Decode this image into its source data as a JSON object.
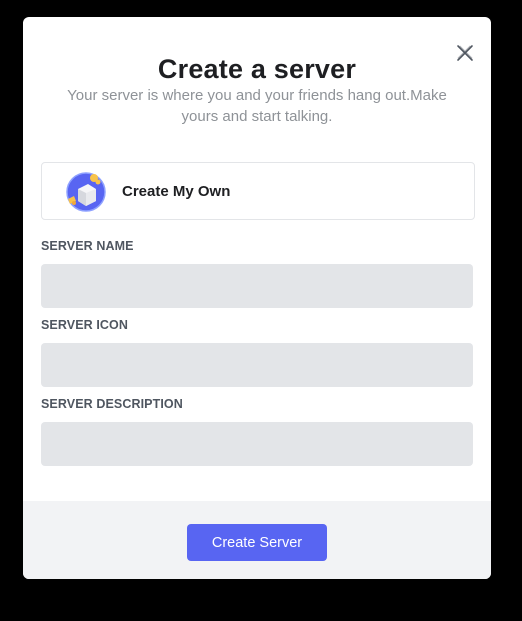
{
  "modal": {
    "title": "Create a server",
    "subtitle": "Your server is where you and your friends hang out.Make yours and start talking.",
    "close_icon": "close-icon"
  },
  "option": {
    "label": "Create My Own",
    "icon": "create-server-icon"
  },
  "fields": [
    {
      "label": "SERVER NAME",
      "value": "",
      "placeholder": ""
    },
    {
      "label": "SERVER ICON",
      "value": "",
      "placeholder": ""
    },
    {
      "label": "SERVER DESCRIPTION",
      "value": "",
      "placeholder": ""
    }
  ],
  "footer": {
    "submit_label": "Create Server"
  },
  "colors": {
    "accent": "#5865f2",
    "input_bg": "#e3e5e8",
    "footer_bg": "#f2f3f5",
    "backdrop": "#000000"
  }
}
